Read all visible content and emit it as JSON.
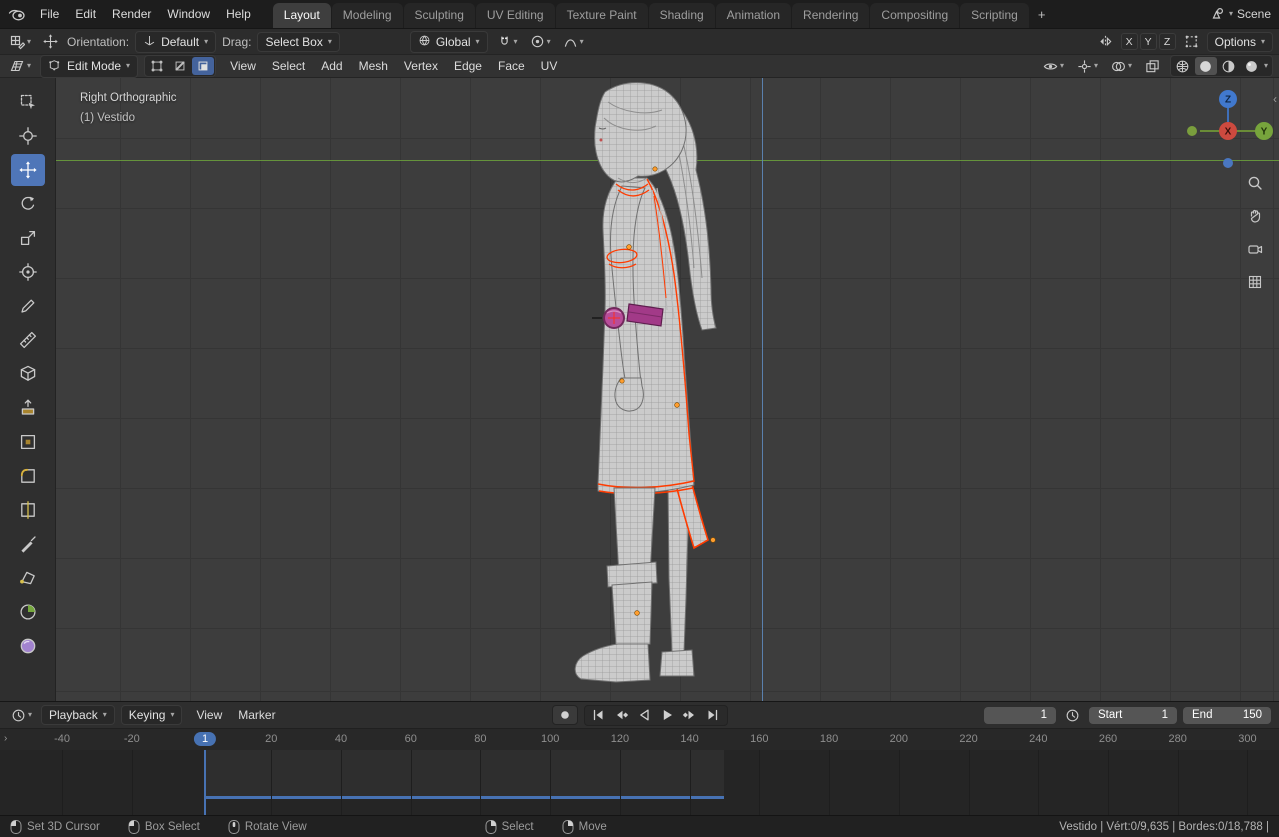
{
  "colors": {
    "accent": "#4772b3",
    "selected_edge": "#ff3b00",
    "active_element": "#ff9d2e",
    "axis_x": "#cd4a3f",
    "axis_y": "#77a43c",
    "axis_z": "#4179ce"
  },
  "topbar": {
    "menus": [
      "File",
      "Edit",
      "Render",
      "Window",
      "Help"
    ],
    "workspaces": [
      {
        "label": "Layout",
        "active": true
      },
      {
        "label": "Modeling"
      },
      {
        "label": "Sculpting"
      },
      {
        "label": "UV Editing"
      },
      {
        "label": "Texture Paint"
      },
      {
        "label": "Shading"
      },
      {
        "label": "Animation"
      },
      {
        "label": "Rendering"
      },
      {
        "label": "Compositing"
      },
      {
        "label": "Scripting"
      }
    ],
    "add_workspace": "+",
    "scene_label": "Scene"
  },
  "tool_settings": {
    "orientation_label": "Orientation:",
    "orientation_value": "Default",
    "drag_label": "Drag:",
    "drag_value": "Select Box",
    "transform_orientation": "Global",
    "mirror_axes": [
      "X",
      "Y",
      "Z"
    ],
    "options_label": "Options"
  },
  "viewport_header": {
    "mode": "Edit Mode",
    "menus": [
      "View",
      "Select",
      "Add",
      "Mesh",
      "Vertex",
      "Edge",
      "Face",
      "UV"
    ]
  },
  "viewport": {
    "view_label": "Right Orthographic",
    "object_label": "(1) Vestido",
    "gizmo_axes": {
      "x": "X",
      "y": "Y",
      "z": "Z"
    }
  },
  "tools": [
    {
      "name": "select-box",
      "icon": "select-box"
    },
    {
      "name": "cursor",
      "icon": "cursor"
    },
    {
      "name": "move",
      "icon": "move",
      "active": true
    },
    {
      "name": "rotate",
      "icon": "rotate"
    },
    {
      "name": "scale",
      "icon": "scale"
    },
    {
      "name": "transform",
      "icon": "transform"
    },
    {
      "name": "annotate",
      "icon": "annotate"
    },
    {
      "name": "measure",
      "icon": "measure"
    },
    {
      "name": "add-cube",
      "icon": "add-cube"
    },
    {
      "name": "extrude-region",
      "icon": "extrude"
    },
    {
      "name": "inset-faces",
      "icon": "inset"
    },
    {
      "name": "bevel",
      "icon": "bevel"
    },
    {
      "name": "loop-cut",
      "icon": "loop-cut"
    },
    {
      "name": "knife",
      "icon": "knife"
    },
    {
      "name": "poly-build",
      "icon": "poly-build"
    },
    {
      "name": "spin",
      "icon": "spin"
    },
    {
      "name": "smooth",
      "icon": "smooth"
    }
  ],
  "timeline": {
    "playback_label": "Playback",
    "keying_label": "Keying",
    "menus": [
      "View",
      "Marker"
    ],
    "current_frame": 1,
    "frame_field_value": "1",
    "start_label": "Start",
    "start_value": 1,
    "end_label": "End",
    "end_value": 150,
    "ticks": [
      -40,
      -20,
      20,
      40,
      60,
      80,
      100,
      120,
      140,
      160,
      180,
      200,
      220,
      240,
      260,
      280,
      300
    ]
  },
  "statusbar": {
    "hints": [
      {
        "button": "left",
        "label": "Set 3D Cursor"
      },
      {
        "button": "left",
        "label": "Box Select"
      },
      {
        "button": "middle",
        "label": "Rotate View"
      },
      {
        "button": "right",
        "label": "Select"
      },
      {
        "button": "right",
        "label": "Move"
      }
    ],
    "stats": "Vestido | Vért:0/9,635 | Bordes:0/18,788 |"
  }
}
